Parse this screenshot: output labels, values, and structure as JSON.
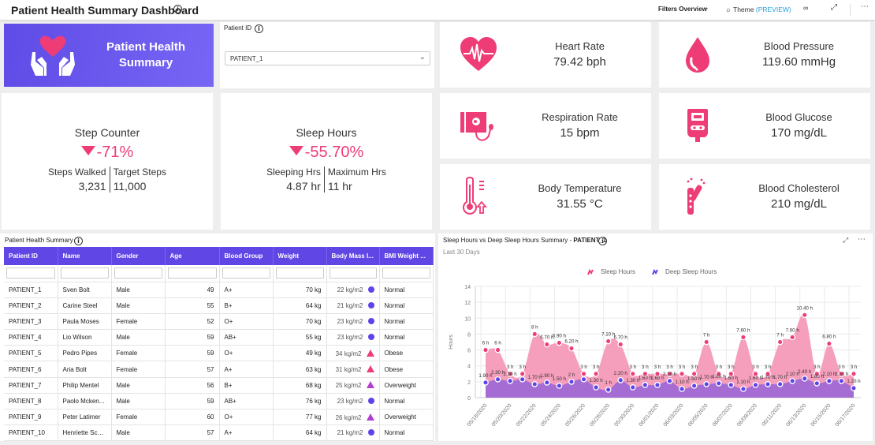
{
  "header": {
    "title": "Patient Health Summary Dashboard",
    "filters_label": "Filters Overview",
    "theme_label": "Theme",
    "theme_preview": "(PREVIEW)"
  },
  "banner": {
    "line1": "Patient Health",
    "line2": "Summary"
  },
  "patient_filter": {
    "label": "Patient ID",
    "selected": "PATIENT_1"
  },
  "colors": {
    "accent": "#5f46e5",
    "pink": "#ee3d76",
    "purple": "#b13fd0"
  },
  "vitals": [
    {
      "label": "Heart Rate",
      "value": "79.42 bph",
      "icon": "heart-rate-icon"
    },
    {
      "label": "Blood Pressure",
      "value": "119.60 mmHg",
      "icon": "blood-drop-icon"
    },
    {
      "label": "Respiration Rate",
      "value": "15 bpm",
      "icon": "blood-pressure-monitor-icon"
    },
    {
      "label": "Blood Glucose",
      "value": "170 mg/dL",
      "icon": "glucometer-icon"
    },
    {
      "label": "Body Temperature",
      "value": "31.55 °C",
      "icon": "thermometer-icon"
    },
    {
      "label": "Blood Cholesterol",
      "value": "210 mg/dL",
      "icon": "test-tubes-icon"
    }
  ],
  "step_counter": {
    "title": "Step Counter",
    "change": "-71%",
    "left_label": "Steps Walked",
    "left_value": "3,231",
    "right_label": "Target Steps",
    "right_value": "11,000"
  },
  "sleep_hours": {
    "title": "Sleep Hours",
    "change": "-55.70%",
    "left_label": "Sleeping Hrs",
    "left_value": "4.87 hr",
    "right_label": "Maximum Hrs",
    "right_value": "11 hr"
  },
  "table": {
    "title": "Patient Health Summary",
    "columns": [
      "Patient ID",
      "Name",
      "Gender",
      "Age",
      "Blood Group",
      "Weight",
      "Body Mass I...",
      "BMI Weight ..."
    ],
    "rows": [
      [
        "PATIENT_1",
        "Sven Bolt",
        "Male",
        "49",
        "A+",
        "70 kg",
        "22 kg/m2",
        "Normal"
      ],
      [
        "PATIENT_2",
        "Carine Steel",
        "Male",
        "55",
        "B+",
        "64 kg",
        "21 kg/m2",
        "Normal"
      ],
      [
        "PATIENT_3",
        "Paula Moses",
        "Female",
        "52",
        "O+",
        "70 kg",
        "23 kg/m2",
        "Normal"
      ],
      [
        "PATIENT_4",
        "Lio Wilson",
        "Male",
        "59",
        "AB+",
        "55 kg",
        "23 kg/m2",
        "Normal"
      ],
      [
        "PATIENT_5",
        "Pedro Pipes",
        "Female",
        "59",
        "O+",
        "49 kg",
        "34 kg/m2",
        "Obese"
      ],
      [
        "PATIENT_6",
        "Aria Bolt",
        "Female",
        "57",
        "A+",
        "63 kg",
        "31 kg/m2",
        "Obese"
      ],
      [
        "PATIENT_7",
        "Philip Mentel",
        "Male",
        "56",
        "B+",
        "68 kg",
        "25 kg/m2",
        "Overweight"
      ],
      [
        "PATIENT_8",
        "Paolo Mcken...",
        "Male",
        "59",
        "AB+",
        "76 kg",
        "23 kg/m2",
        "Normal"
      ],
      [
        "PATIENT_9",
        "Peter Latimer",
        "Female",
        "60",
        "O+",
        "77 kg",
        "26 kg/m2",
        "Overweight"
      ],
      [
        "PATIENT_10",
        "Henriette Sch...",
        "Male",
        "57",
        "A+",
        "64 kg",
        "21 kg/m2",
        "Normal"
      ]
    ]
  },
  "chart_panel": {
    "title": "Sleep Hours vs Deep Sleep Hours Summary",
    "title_patient": "PATIENT_1",
    "subtitle": "Last 30 Days"
  },
  "chart_data": {
    "type": "area",
    "title": "Sleep Hours vs Deep Sleep Hours Summary - PATIENT_1",
    "subtitle": "Last 30 Days",
    "xlabel": "",
    "ylabel": "Hours",
    "ylim": [
      0,
      14
    ],
    "yticks": [
      0,
      2,
      4,
      6,
      8,
      10,
      12,
      14
    ],
    "grid": true,
    "legend": "top-center",
    "x": [
      "05/18/2020",
      "05/19/2020",
      "05/20/2020",
      "05/21/2020",
      "05/22/2020",
      "05/23/2020",
      "05/24/2020",
      "05/25/2020",
      "05/26/2020",
      "05/27/2020",
      "05/28/2020",
      "05/29/2020",
      "05/30/2020",
      "05/31/2020",
      "06/01/2020",
      "06/02/2020",
      "06/03/2020",
      "06/04/2020",
      "06/05/2020",
      "06/06/2020",
      "06/07/2020",
      "06/08/2020",
      "06/09/2020",
      "06/10/2020",
      "06/11/2020",
      "06/12/2020",
      "06/13/2020",
      "06/14/2020",
      "06/15/2020",
      "06/16/2020",
      "06/17/2020"
    ],
    "xtick_labels": [
      "05/18/2020",
      "05/20/2020",
      "05/22/2020",
      "05/24/2020",
      "05/26/2020",
      "05/28/2020",
      "05/30/2020",
      "06/01/2020",
      "06/03/2020",
      "06/05/2020",
      "06/07/2020",
      "06/09/2020",
      "06/11/2020",
      "06/13/2020",
      "06/15/2020",
      "06/17/2020"
    ],
    "series": [
      {
        "name": "Sleep Hours",
        "color": "#ee3d76",
        "fill": "#f49ab8",
        "values": [
          6,
          6,
          3,
          3,
          8,
          6.7,
          6.9,
          6.2,
          3,
          3,
          7.1,
          6.7,
          3,
          3,
          3,
          3,
          3,
          3,
          7,
          3,
          3,
          7.6,
          3,
          3,
          7,
          7.6,
          10.4,
          3,
          6.8,
          3,
          3
        ],
        "labels": [
          "6 h",
          "6 h",
          "3 h",
          "3 h",
          "8 h",
          "6.70 h",
          "6.90 h",
          "6.20 h",
          "3 h",
          "3 h",
          "7.10 h",
          "6.70 h",
          "3 h",
          "3 h",
          "3 h",
          "3 h",
          "3 h",
          "3 h",
          "7 h",
          "3 h",
          "3 h",
          "7.60 h",
          "3 h",
          "3 h",
          "7 h",
          "7.60 h",
          "10.40 h",
          "3 h",
          "6.80 h",
          "3 h",
          "3 h"
        ]
      },
      {
        "name": "Deep Sleep Hours",
        "color": "#5c44e8",
        "fill": "#a56dd4",
        "values": [
          1.9,
          2.3,
          2.1,
          2.3,
          1.7,
          1.9,
          1.5,
          2,
          2.3,
          1.3,
          1,
          2.2,
          1.3,
          1.6,
          1.6,
          2.1,
          1.1,
          1.5,
          1.7,
          1.8,
          1.6,
          1.1,
          1.6,
          1.7,
          1.7,
          2.1,
          2.4,
          1.8,
          2.1,
          2.1,
          1.2
        ],
        "labels": [
          "1.90 h",
          "2.30 h",
          "2.10 h",
          "",
          "1.70 h",
          "1.90 h",
          "1.50 h",
          "2 h",
          "",
          "1.30 h",
          "1 h",
          "2.20 h",
          "1.30 h",
          "1.60 h",
          "1.60 h",
          "2.10 h",
          "1.10 h",
          "1.50 h",
          "1.70 h",
          "1.80 h",
          "1.60 h",
          "1.10 h",
          "1.60 h",
          "1.70 h",
          "1.70 h",
          "2.10 h",
          "2.40 h",
          "1.80 h",
          "2.10 h",
          "2.10 h",
          "1.20 h"
        ]
      }
    ]
  }
}
